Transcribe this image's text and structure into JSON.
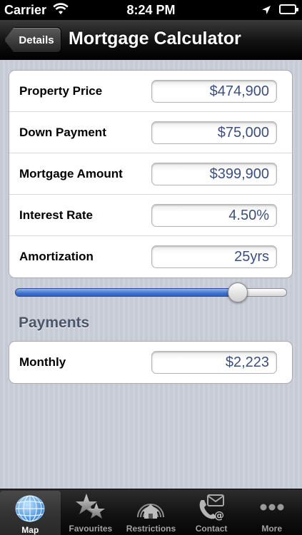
{
  "status_bar": {
    "carrier": "Carrier",
    "time": "8:24 PM"
  },
  "nav": {
    "back_label": "Details",
    "title": "Mortgage Calculator"
  },
  "inputs": [
    {
      "label": "Property Price",
      "value": "$474,900"
    },
    {
      "label": "Down Payment",
      "value": "$75,000"
    },
    {
      "label": "Mortgage Amount",
      "value": "$399,900"
    },
    {
      "label": "Interest Rate",
      "value": "4.50%"
    },
    {
      "label": "Amortization",
      "value": "25yrs"
    }
  ],
  "slider": {
    "fraction": 0.82
  },
  "payments": {
    "header": "Payments",
    "rows": [
      {
        "label": "Monthly",
        "value": "$2,223"
      }
    ]
  },
  "tabs": [
    {
      "label": "Map",
      "icon": "globe-icon",
      "selected": true
    },
    {
      "label": "Favourites",
      "icon": "stars-icon",
      "selected": false
    },
    {
      "label": "Restrictions",
      "icon": "house-waves-icon",
      "selected": false
    },
    {
      "label": "Contact",
      "icon": "phone-mail-icon",
      "selected": false
    },
    {
      "label": "More",
      "icon": "more-dots-icon",
      "selected": false
    }
  ],
  "colors": {
    "field_text": "#3b4f7e",
    "slider_fill": "#3f72cf",
    "section_header": "#4c566a"
  }
}
